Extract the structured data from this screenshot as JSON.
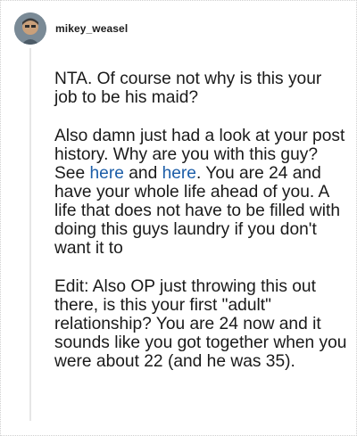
{
  "comment": {
    "username": "mikey_weasel",
    "avatar_icon": "user-avatar-icon",
    "paragraphs": {
      "p1": "NTA. Of course not why is this your job to be his maid?",
      "p2_before": "Also damn just had a look at your post history. Why are you with this guy? See ",
      "link1": "here",
      "p2_mid": " and ",
      "link2": "here",
      "p2_after": ". You are 24 and have your whole life ahead of you. A life that does not have to be filled with doing this guys laundry if you don't want it to",
      "p3": "Edit: Also OP just throwing this out there, is this your first \"adult\" relationship? You are 24 now and it sounds like you got together when you were about 22 (and he was 35)."
    },
    "colors": {
      "text": "#1a1a1a",
      "link": "#1d5ea8",
      "thread_line": "#e6e6e6"
    }
  }
}
